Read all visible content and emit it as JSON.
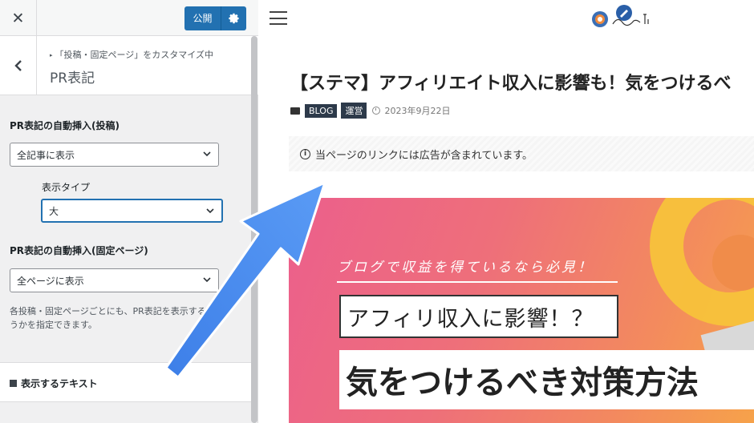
{
  "sidebar": {
    "close_label": "✕",
    "publish_label": "公開",
    "gear_icon": "gear-icon",
    "breadcrumb": "「投稿・固定ページ」をカスタマイズ中",
    "section_title": "PR表記",
    "control1": {
      "label": "PR表記の自動挿入(投稿)",
      "value": "全記事に表示",
      "sub_label": "表示タイプ",
      "sub_value": "大"
    },
    "control2": {
      "label": "PR表記の自動挿入(固定ページ)",
      "value": "全ページに表示",
      "description": "各投稿・固定ページごとにも、PR表記を表示するかどうかを指定できます。"
    },
    "text_section_label": "表示するテキスト"
  },
  "preview": {
    "post_title": "【ステマ】アフィリエイト収入に影響も！気をつけるべ",
    "tags": [
      "BLOG",
      "運営"
    ],
    "date": "2023年9月22日",
    "pr_notice": "当ページのリンクには広告が含まれています。",
    "eyecatch": {
      "subtitle": "ブログで収益を得ているなら必見！",
      "line1": "アフィリ収入に影響！？",
      "line2": "気をつけるべき対策方法"
    }
  },
  "colors": {
    "accent": "#2271b1",
    "arrow": "#4a8ef0"
  }
}
